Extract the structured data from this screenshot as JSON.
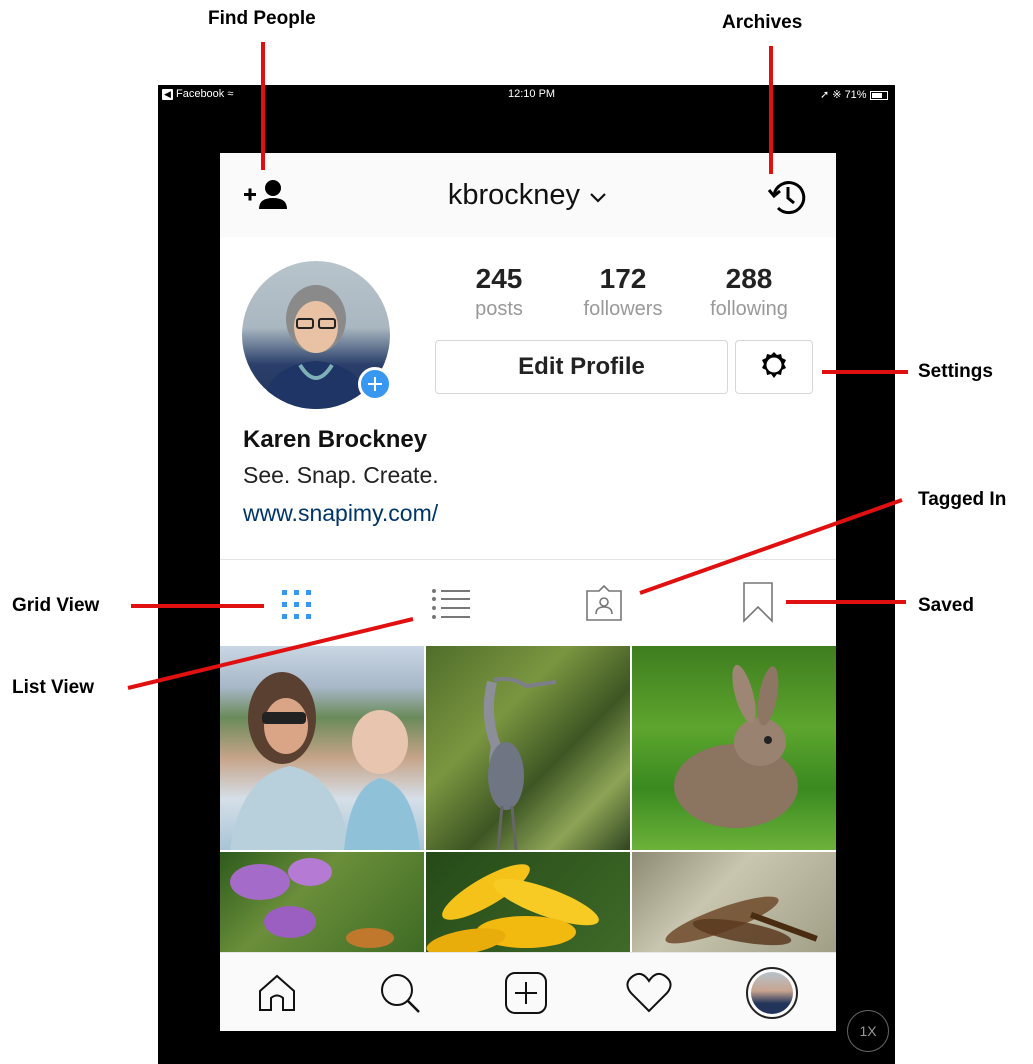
{
  "callouts": {
    "find_people": "Find People",
    "archives": "Archives",
    "settings": "Settings",
    "tagged_in": "Tagged In",
    "grid_view": "Grid View",
    "saved": "Saved",
    "list_view": "List View"
  },
  "status_bar": {
    "back_app": "Facebook",
    "time": "12:10 PM",
    "battery": "71%"
  },
  "header": {
    "username": "kbrockney",
    "find_people_icon": "add-person-icon",
    "archive_icon": "archive-clock-icon"
  },
  "profile": {
    "stats": [
      {
        "value": "245",
        "label": "posts"
      },
      {
        "value": "172",
        "label": "followers"
      },
      {
        "value": "288",
        "label": "following"
      }
    ],
    "edit_button": "Edit Profile",
    "name": "Karen Brockney",
    "bio": "See. Snap. Create.",
    "website": "www.snapimy.com/"
  },
  "tabs": [
    {
      "name": "grid",
      "icon": "grid-icon",
      "active": true
    },
    {
      "name": "list",
      "icon": "list-icon",
      "active": false
    },
    {
      "name": "tagged",
      "icon": "tagged-icon",
      "active": false
    },
    {
      "name": "saved",
      "icon": "bookmark-icon",
      "active": false
    }
  ],
  "grid_photos": [
    "woman-with-baby",
    "heron",
    "rabbit",
    "purple-flowers",
    "yellow-flower",
    "dragonfly"
  ],
  "bottom_nav": [
    "home-icon",
    "search-icon",
    "new-post-icon",
    "heart-icon",
    "profile-avatar"
  ],
  "zoom_badge": "1X",
  "colors": {
    "accent_blue": "#3897f0",
    "link_blue": "#003569",
    "callout_red": "#e01010"
  }
}
